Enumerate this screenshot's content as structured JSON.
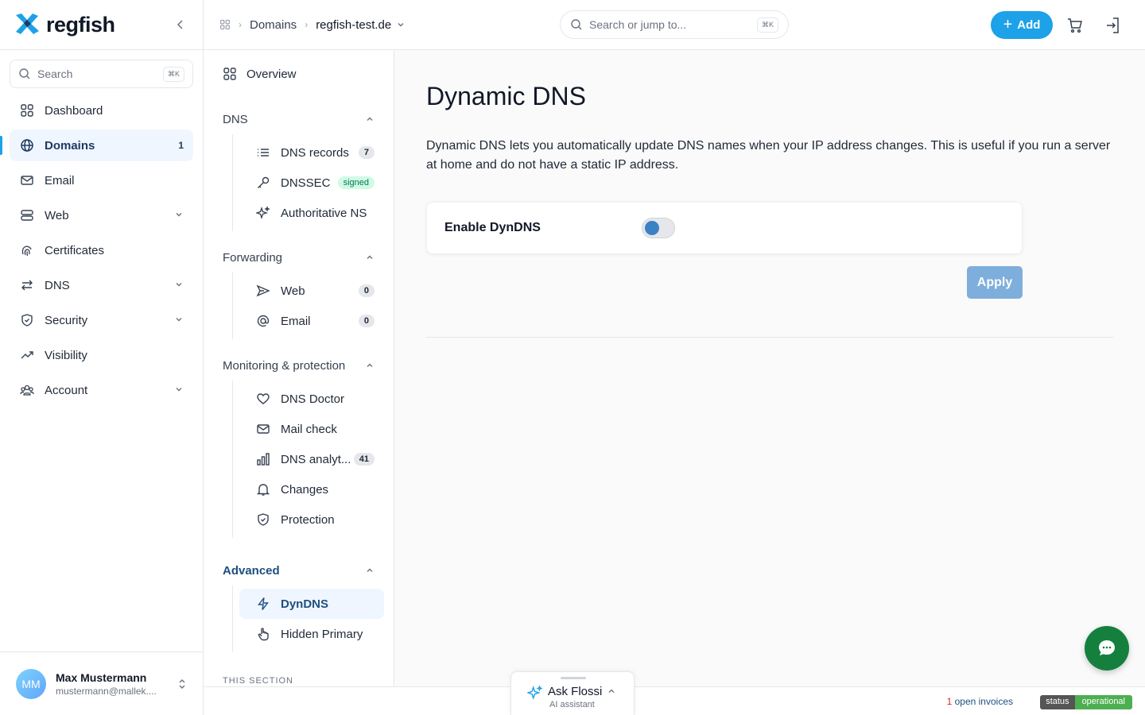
{
  "brand": {
    "name": "regfish",
    "accent": "#1da1e8",
    "dark": "#1e3a5f"
  },
  "sidebar": {
    "search_placeholder": "Search",
    "search_shortcut": "⌘K",
    "items": [
      {
        "label": "Dashboard",
        "icon": "grid-icon"
      },
      {
        "label": "Domains",
        "icon": "globe-icon",
        "count": "1",
        "active": true
      },
      {
        "label": "Email",
        "icon": "mail-icon"
      },
      {
        "label": "Web",
        "icon": "server-icon",
        "expandable": true
      },
      {
        "label": "Certificates",
        "icon": "fingerprint-icon"
      },
      {
        "label": "DNS",
        "icon": "arrows-icon",
        "expandable": true
      },
      {
        "label": "Security",
        "icon": "shield-icon",
        "expandable": true
      },
      {
        "label": "Visibility",
        "icon": "trend-icon"
      },
      {
        "label": "Account",
        "icon": "users-icon",
        "expandable": true
      }
    ],
    "user": {
      "initials": "MM",
      "name": "Max Mustermann",
      "email": "mustermann@mallek...."
    }
  },
  "topbar": {
    "breadcrumb": [
      "Domains",
      "regfish-test.de"
    ],
    "search_placeholder": "Search or jump to...",
    "search_shortcut": "⌘K",
    "add_label": "Add"
  },
  "subnav": {
    "overview": "Overview",
    "groups": [
      {
        "title": "DNS",
        "items": [
          {
            "label": "DNS records",
            "badge": "7",
            "icon": "list-icon"
          },
          {
            "label": "DNSSEC",
            "badge": "signed",
            "badge_style": "green",
            "icon": "key-icon"
          },
          {
            "label": "Authoritative NS",
            "icon": "sparkles-icon"
          }
        ]
      },
      {
        "title": "Forwarding",
        "items": [
          {
            "label": "Web",
            "badge": "0",
            "icon": "send-icon"
          },
          {
            "label": "Email",
            "badge": "0",
            "icon": "at-icon"
          }
        ]
      },
      {
        "title": "Monitoring & protection",
        "items": [
          {
            "label": "DNS Doctor",
            "icon": "heart-icon"
          },
          {
            "label": "Mail check",
            "icon": "mail-icon"
          },
          {
            "label": "DNS analyt...",
            "badge": "41",
            "icon": "bar-chart-icon"
          },
          {
            "label": "Changes",
            "icon": "bell-icon"
          },
          {
            "label": "Protection",
            "icon": "shield-check-icon"
          }
        ]
      },
      {
        "title": "Advanced",
        "items": [
          {
            "label": "DynDNS",
            "icon": "bolt-icon",
            "active": true
          },
          {
            "label": "Hidden Primary",
            "icon": "pointer-icon"
          }
        ]
      }
    ],
    "section_label": "THIS SECTION"
  },
  "main": {
    "title": "Dynamic DNS",
    "description": "Dynamic DNS lets you automatically update DNS names when your IP address changes. This is useful if you run a server at home and do not have a static IP address.",
    "toggle_label": "Enable DynDNS",
    "toggle_on": false,
    "apply_label": "Apply"
  },
  "footer": {
    "invoices_count": "1",
    "invoices_text": " open invoices",
    "status_key": "status",
    "status_value": "operational"
  },
  "assistant": {
    "title": "Ask Flossi",
    "subtitle": "AI assistant"
  }
}
